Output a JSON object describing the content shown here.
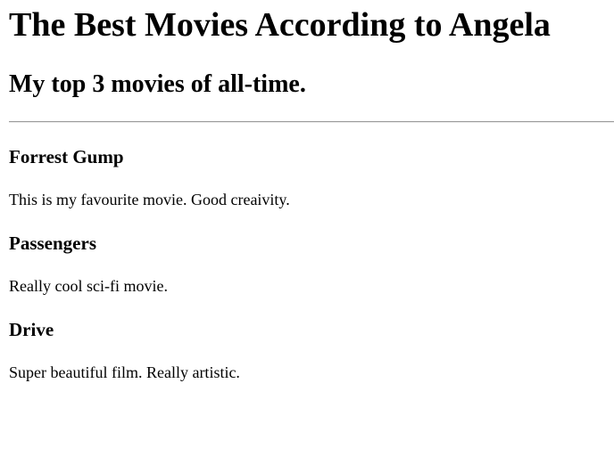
{
  "page": {
    "title": "The Best Movies According to Angela",
    "subtitle": "My top 3 movies of all-time."
  },
  "movies": [
    {
      "title": "Forrest Gump",
      "description": "This is my favourite movie. Good creaivity."
    },
    {
      "title": "Passengers",
      "description": "Really cool sci-fi movie."
    },
    {
      "title": "Drive",
      "description": "Super beautiful film. Really artistic."
    }
  ]
}
